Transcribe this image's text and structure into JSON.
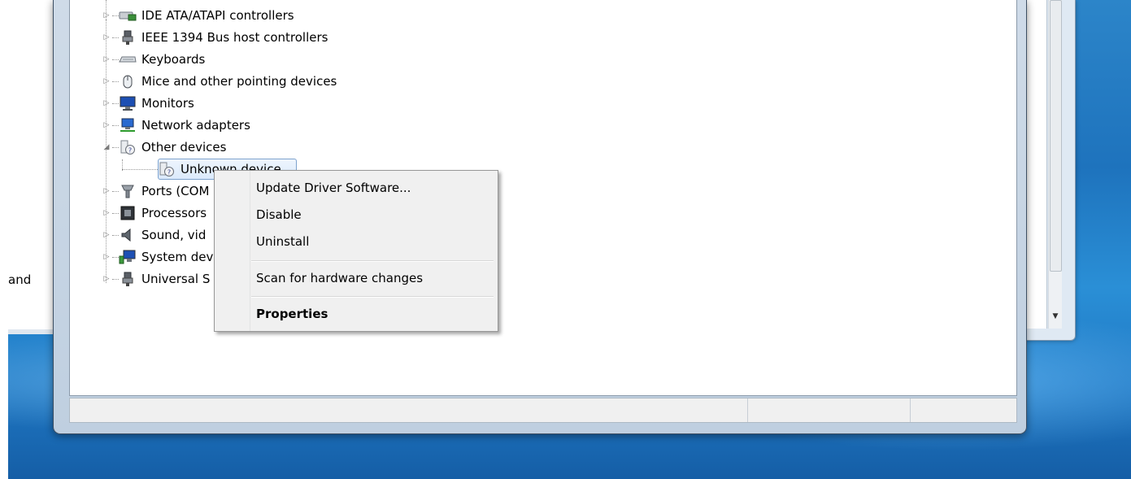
{
  "background_window": {
    "partial_text": "and"
  },
  "tree": {
    "items": [
      {
        "label": "IDE ATA/ATAPI controllers",
        "icon": "ide-controller-icon"
      },
      {
        "label": "IEEE 1394 Bus host controllers",
        "icon": "usb-plug-icon"
      },
      {
        "label": "Keyboards",
        "icon": "keyboard-icon"
      },
      {
        "label": "Mice and other pointing devices",
        "icon": "mouse-icon"
      },
      {
        "label": "Monitors",
        "icon": "monitor-icon"
      },
      {
        "label": "Network adapters",
        "icon": "network-adapter-icon"
      },
      {
        "label": "Other devices",
        "icon": "unknown-device-icon"
      },
      {
        "label": "Unknown device",
        "icon": "unknown-device-icon"
      },
      {
        "label": "Ports (COM",
        "icon": "port-icon"
      },
      {
        "label": "Processors",
        "icon": "processor-icon"
      },
      {
        "label": "Sound, vid",
        "icon": "speaker-icon"
      },
      {
        "label": "System dev",
        "icon": "system-device-icon"
      },
      {
        "label": "Universal S",
        "icon": "usb-plug-icon"
      }
    ]
  },
  "context_menu": {
    "items": [
      {
        "label": "Update Driver Software..."
      },
      {
        "label": "Disable"
      },
      {
        "label": "Uninstall"
      },
      {
        "label": "Scan for hardware changes"
      },
      {
        "label": "Properties"
      }
    ]
  },
  "colors": {
    "desktop": "#1e73bd",
    "menu_background": "#f0f0f0",
    "selection_border": "#7da2ce"
  }
}
